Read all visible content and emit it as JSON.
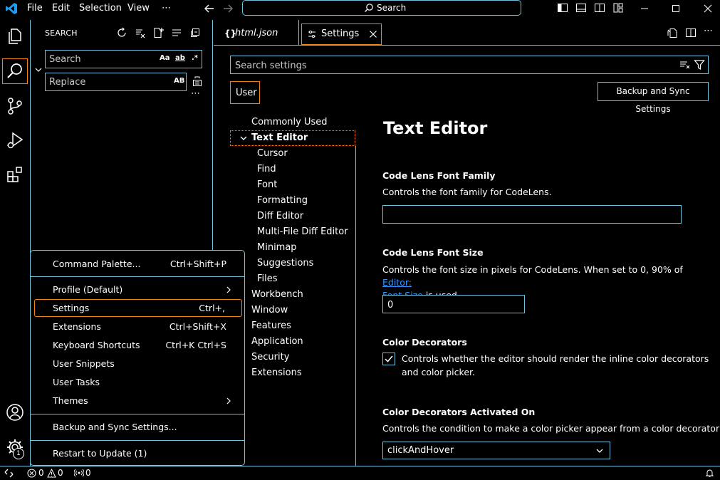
{
  "titlebar": {
    "menus": [
      "File",
      "Edit",
      "Selection",
      "View",
      "⋯"
    ],
    "command_center": "Search"
  },
  "sidebar": {
    "title": "SEARCH",
    "search_placeholder": "Search",
    "replace_placeholder": "Replace",
    "opt_case": "Aa",
    "opt_word": "ab",
    "opt_regex": ".*",
    "opt_preserve": "AB",
    "more": "⋯"
  },
  "tabs": [
    {
      "label": "html.json"
    },
    {
      "label": "Settings"
    }
  ],
  "settings": {
    "search_placeholder": "Search settings",
    "scope_tab": "User",
    "backup_button": "Backup and Sync Settings",
    "toc": {
      "commonly_used": "Commonly Used",
      "text_editor": "Text Editor",
      "cursor": "Cursor",
      "find": "Find",
      "font": "Font",
      "formatting": "Formatting",
      "diff_editor": "Diff Editor",
      "multi_diff": "Multi-File Diff Editor",
      "minimap": "Minimap",
      "suggestions": "Suggestions",
      "files": "Files",
      "workbench": "Workbench",
      "window": "Window",
      "features": "Features",
      "application": "Application",
      "security": "Security",
      "extensions": "Extensions"
    },
    "heading": "Text Editor",
    "codelens_family": {
      "title": "Code Lens Font Family",
      "desc": "Controls the font family for CodeLens.",
      "value": ""
    },
    "codelens_size": {
      "title": "Code Lens Font Size",
      "desc_pre": "Controls the font size in pixels for CodeLens. When set to 0, 90% of ",
      "desc_link_1": "Editor:",
      "desc_link_2": "Font Size",
      "desc_post": " is used.",
      "value": "0"
    },
    "color_decorators": {
      "title": "Color Decorators",
      "desc_1": "Controls whether the editor should render the inline color decorators",
      "desc_2": "and color picker.",
      "checked": true
    },
    "color_decorators_activated": {
      "title": "Color Decorators Activated On",
      "desc": "Controls the condition to make a color picker appear from a color decorator",
      "value": "clickAndHover"
    }
  },
  "context_menu": {
    "items": [
      {
        "label": "Command Palette...",
        "key": "Ctrl+Shift+P"
      },
      {
        "label": "Profile (Default)",
        "key": ""
      },
      {
        "label": "Settings",
        "key": "Ctrl+,"
      },
      {
        "label": "Extensions",
        "key": "Ctrl+Shift+X"
      },
      {
        "label": "Keyboard Shortcuts",
        "key": "Ctrl+K Ctrl+S"
      },
      {
        "label": "User Snippets",
        "key": ""
      },
      {
        "label": "User Tasks",
        "key": ""
      },
      {
        "label": "Themes",
        "key": ""
      },
      {
        "label": "Backup and Sync Settings...",
        "key": ""
      },
      {
        "label": "Restart to Update (1)",
        "key": ""
      }
    ]
  },
  "activity": {
    "badge": "1"
  },
  "statusbar": {
    "errors": "0",
    "warnings": "0",
    "ports": "0"
  },
  "colors": {
    "border": "#6fc3df",
    "focus": "#f38518",
    "link": "#3794ff",
    "logo": "#1f9cf0"
  }
}
